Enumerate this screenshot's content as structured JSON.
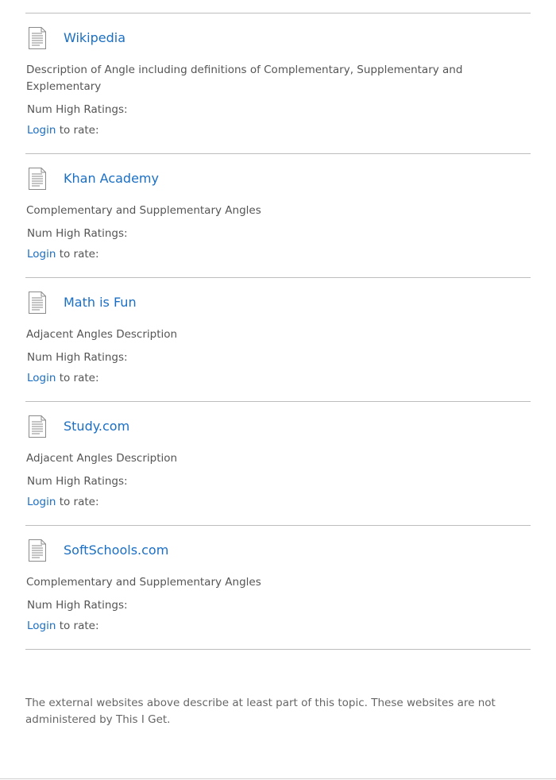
{
  "resources": [
    {
      "title": "Wikipedia",
      "description": "Description of Angle including definitions of Complementary, Supplementary and Explementary",
      "ratings_label": "Num High Ratings:",
      "login_label": "Login",
      "rate_suffix": " to rate:",
      "icon": "document-icon"
    },
    {
      "title": "Khan Academy",
      "description": "Complementary and Supplementary Angles",
      "ratings_label": "Num High Ratings:",
      "login_label": "Login",
      "rate_suffix": " to rate:",
      "icon": "document-icon"
    },
    {
      "title": "Math is Fun",
      "description": "Adjacent Angles Description",
      "ratings_label": "Num High Ratings:",
      "login_label": "Login",
      "rate_suffix": " to rate:",
      "icon": "document-icon"
    },
    {
      "title": "Study.com",
      "description": "Adjacent Angles Description",
      "ratings_label": "Num High Ratings:",
      "login_label": "Login",
      "rate_suffix": " to rate:",
      "icon": "document-icon"
    },
    {
      "title": "SoftSchools.com",
      "description": "Complementary and Supplementary Angles",
      "ratings_label": "Num High Ratings:",
      "login_label": "Login",
      "rate_suffix": " to rate:",
      "icon": "document-icon"
    }
  ],
  "footer": {
    "note": "The external websites above describe at least part of this topic. These websites are not administered by This I Get."
  },
  "colors": {
    "link": "#1a6fc4",
    "text": "#555555",
    "rule": "#bdbdbd"
  }
}
